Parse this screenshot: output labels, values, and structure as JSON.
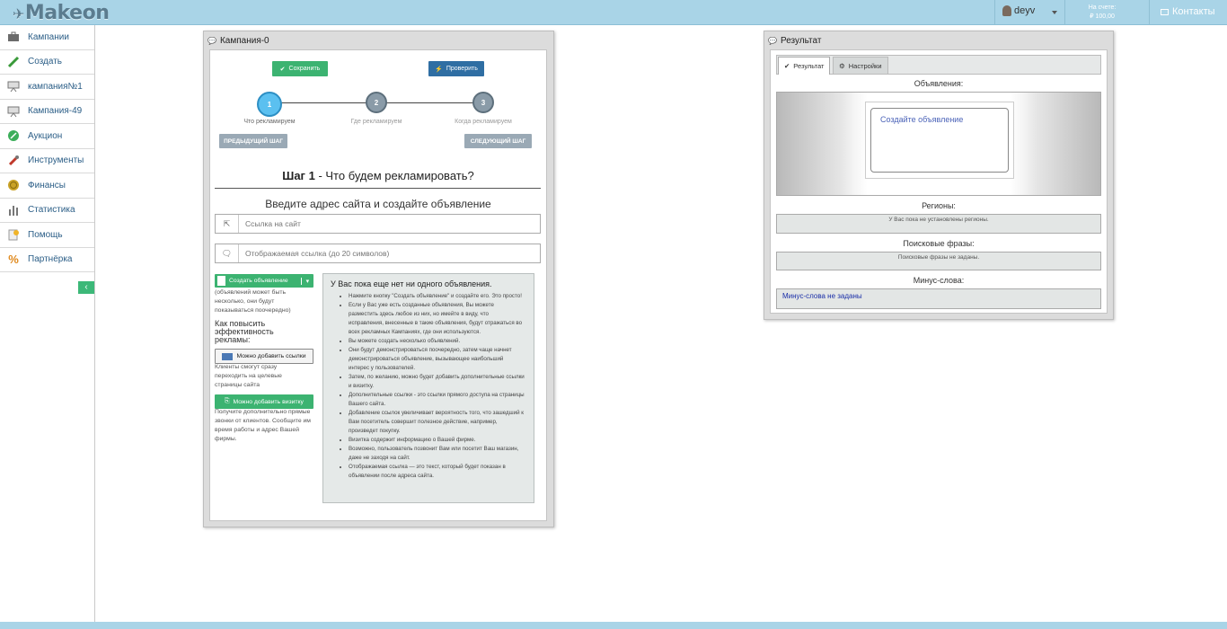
{
  "topbar": {
    "logo": "Makeon",
    "user": "deyv",
    "balance_label": "На счете:",
    "balance_value": "₽ 100,00",
    "contacts": "Контакты"
  },
  "sidebar": {
    "items": [
      {
        "label": "Кампании",
        "icon": "briefcase-icon"
      },
      {
        "label": "Создать",
        "icon": "pencil-icon"
      },
      {
        "label": "кампания№1",
        "icon": "presentation-icon"
      },
      {
        "label": "Кампания-49",
        "icon": "presentation-icon"
      },
      {
        "label": "Аукцион",
        "icon": "auction-icon"
      },
      {
        "label": "Инструменты",
        "icon": "wrench-icon"
      },
      {
        "label": "Финансы",
        "icon": "coin-icon"
      },
      {
        "label": "Статистика",
        "icon": "bar-chart-icon"
      },
      {
        "label": "Помощь",
        "icon": "help-icon"
      },
      {
        "label": "Партнёрка",
        "icon": "percent-icon"
      }
    ],
    "collapse_glyph": "‹"
  },
  "campaign": {
    "title": "Кампания-0",
    "save": "Сохранить",
    "check": "Проверить",
    "steps": [
      {
        "num": "1",
        "label": "Что рекламируем",
        "color": "#5bc0f0"
      },
      {
        "num": "2",
        "label": "Где рекламируем",
        "color": "#8a9ba8"
      },
      {
        "num": "3",
        "label": "Когда рекламируем",
        "color": "#8a9ba8"
      }
    ],
    "prev_step": "ПРЕДЫДУЩИЙ ШАГ",
    "next_step": "СЛЕДУЮЩИЙ ШАГ",
    "heading_bold": "Шаг 1",
    "heading_rest": " - Что будем рекламировать?",
    "subheading": "Введите адрес сайта и создайте объявление",
    "site_placeholder": "Ссылка на сайт",
    "display_placeholder": "Отображаемая ссылка (до 20 символов)",
    "create_ad": "Создать объявление",
    "create_note": "(объявлений может быть несколько, они будут показываться поочередно)",
    "boost_title": "Как повысить эффективность рекламы:",
    "add_links": "Можно добавить ссылки",
    "links_note": "Клиенты смогут сразу переходить на целевые страницы сайта",
    "add_card": "Можно добавить визитку",
    "card_note": "Получите дополнительно прямые звонки от клиентов. Сообщите им время работы и адрес Вашей фирмы.",
    "info_title": "У Вас пока еще нет ни одного объявления.",
    "info_items": [
      "Нажмите кнопку \"Создать объявление\" и создайте его. Это просто!",
      "Если у Вас уже есть созданные объявления, Вы можете разместить здесь любое из них, но имейте в виду, что исправления, внесенные в такие объявления, будут отражаться во всех рекламных Кампаниях, где они используются.",
      "Вы можете создать несколько объявлений.",
      "Они будут демонстрироваться поочередно, затем чаще начнет демонстрироваться объявление, вызывающее наибольший интерес у пользователей.",
      "Затем, по желанию, можно будет добавить дополнительные ссылки и визитку.",
      "Дополнительные ссылки - это ссылки прямого доступа на страницы Вашего сайта.",
      "Добавление ссылок увеличивает вероятность того, что зашедший к Вам посетитель совершит полезное действие, например, произведет покупку.",
      "Визитка содержит информацию о Вашей фирме.",
      "Возможно, пользователь позвонит Вам или посетит Ваш магазин, даже не заходя на сайт.",
      "Отображаемая ссылка — это текст, который будет показан в объявлении после адреса сайта."
    ]
  },
  "result": {
    "title": "Результат",
    "tab_result": "Результат",
    "tab_settings": "Настройки",
    "ads_label": "Объявления:",
    "create_ad_link": "Создайте объявление",
    "regions_label": "Регионы:",
    "regions_text": "У Вас пока не установлены регионы.",
    "phrases_label": "Поисковые фразы:",
    "phrases_text": "Поисковые фразы не заданы.",
    "minus_label": "Минус-слова:",
    "minus_text": "Минус-слова не заданы"
  },
  "colors": {
    "topbar": "#a9d4e7",
    "green": "#3cb371",
    "blue": "#2f6ea3",
    "link": "#2a5d86"
  }
}
